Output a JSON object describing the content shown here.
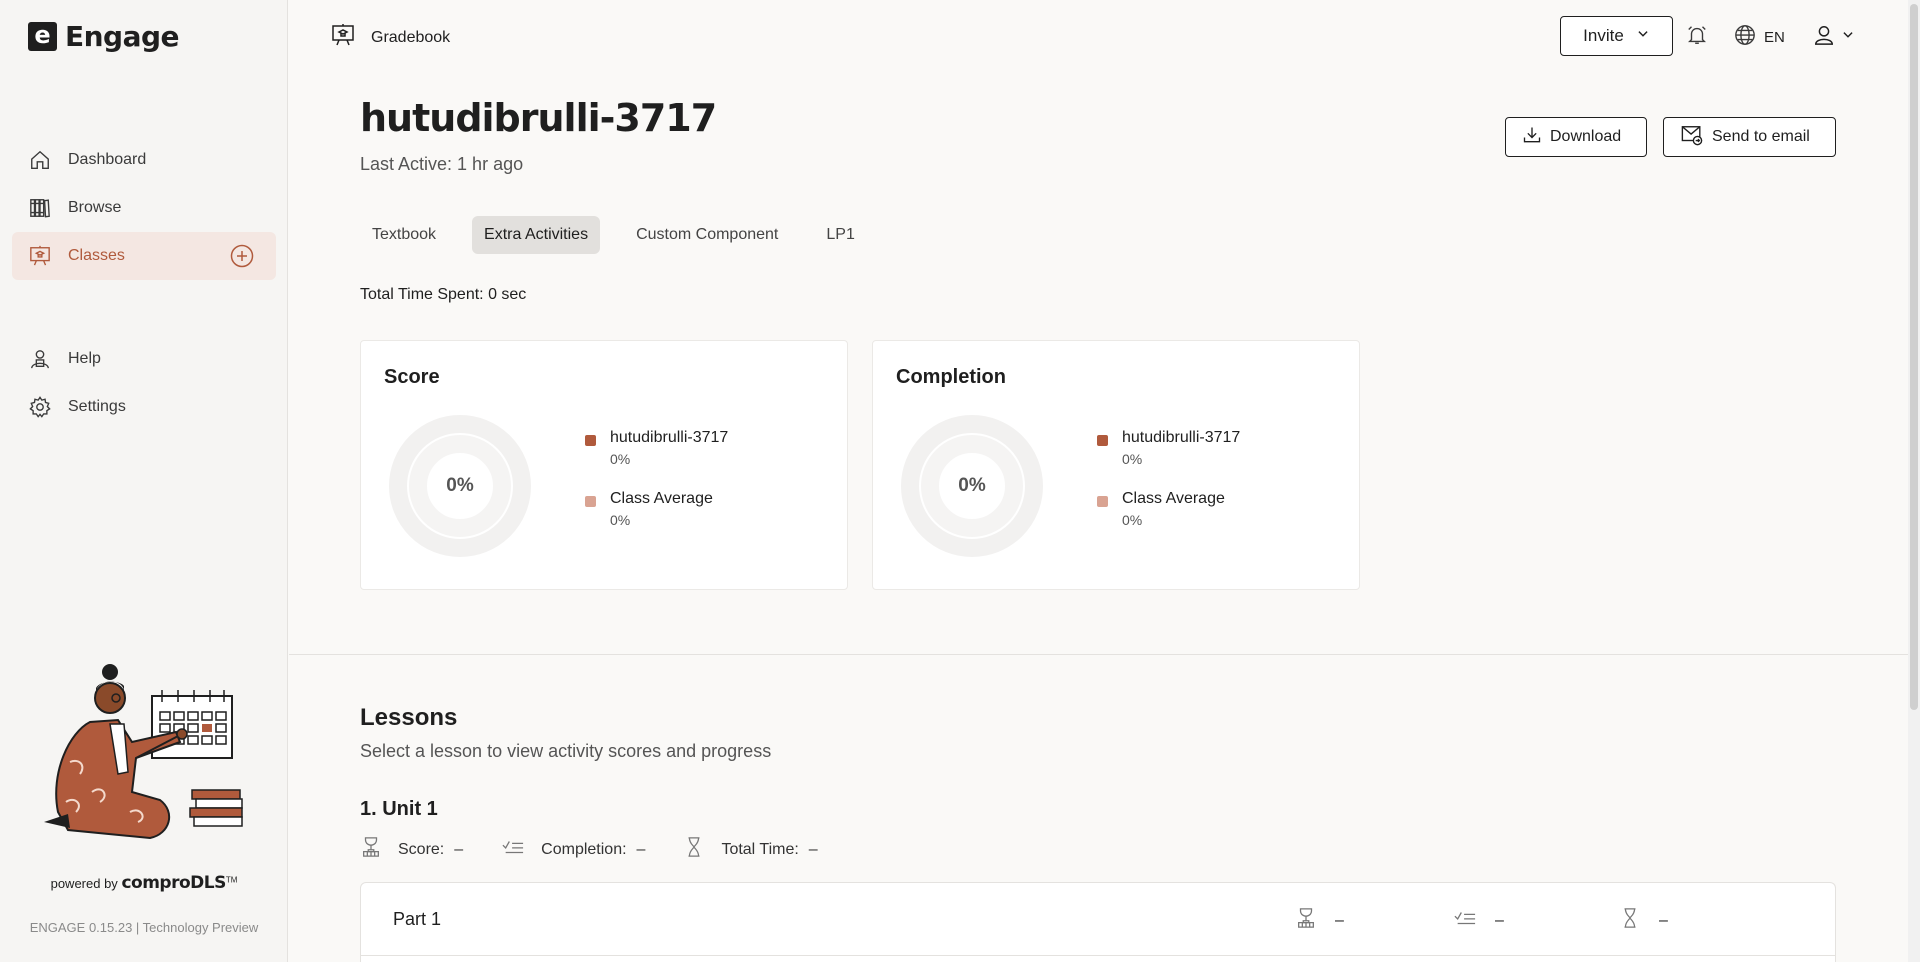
{
  "app": {
    "name": "Engage",
    "logo_letter": "e",
    "version": "ENGAGE 0.15.23 | Technology Preview",
    "powered_by": "powered by",
    "powered_brand": "comproDLS",
    "powered_tm": "TM"
  },
  "sidebar": {
    "items": [
      {
        "label": "Dashboard",
        "icon": "home-icon"
      },
      {
        "label": "Browse",
        "icon": "books-icon"
      },
      {
        "label": "Classes",
        "icon": "classroom-icon",
        "active": true
      }
    ],
    "secondary": [
      {
        "label": "Help",
        "icon": "help-icon"
      },
      {
        "label": "Settings",
        "icon": "gear-icon"
      }
    ]
  },
  "topbar": {
    "breadcrumb": "Gradebook",
    "invite_label": "Invite",
    "language": "EN"
  },
  "student": {
    "name": "hutudibrulli-3717",
    "last_active": "Last Active: 1 hr ago"
  },
  "actions": {
    "download": "Download",
    "send_email": "Send to email"
  },
  "tabs": [
    {
      "label": "Textbook",
      "active": false
    },
    {
      "label": "Extra Activities",
      "active": true
    },
    {
      "label": "Custom Component",
      "active": false
    },
    {
      "label": "LP1",
      "active": false
    }
  ],
  "total_time": "Total Time Spent: 0 sec",
  "score_card": {
    "title": "Score",
    "center": "0%",
    "legend": [
      {
        "name": "hutudibrulli-3717",
        "value": "0%",
        "color": "#b05a3c"
      },
      {
        "name": "Class Average",
        "value": "0%",
        "color": "#d9a392"
      }
    ]
  },
  "completion_card": {
    "title": "Completion",
    "center": "0%",
    "legend": [
      {
        "name": "hutudibrulli-3717",
        "value": "0%",
        "color": "#b05a3c"
      },
      {
        "name": "Class Average",
        "value": "0%",
        "color": "#d9a392"
      }
    ]
  },
  "lessons": {
    "heading": "Lessons",
    "subheading": "Select a lesson to view activity scores and progress",
    "unit": {
      "title": "1. Unit 1",
      "score_label": "Score:",
      "score_value": "–",
      "completion_label": "Completion:",
      "completion_value": "–",
      "time_label": "Total Time:",
      "time_value": "–"
    },
    "parts": [
      {
        "name": "Part 1",
        "score": "–",
        "completion": "–",
        "time": "–"
      }
    ]
  },
  "colors": {
    "accent": "#b05a3c",
    "accent_light": "#d9a392",
    "active_bg": "#f4e7e2"
  }
}
